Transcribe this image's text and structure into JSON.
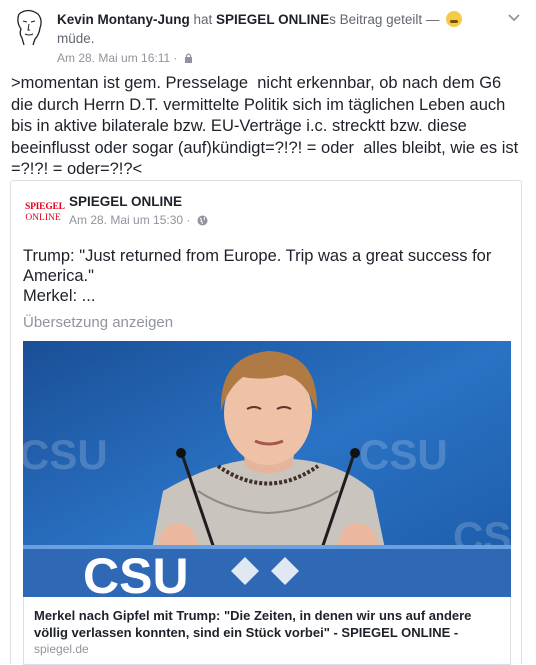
{
  "post": {
    "author": "Kevin Montany-Jung",
    "verb_before": " hat ",
    "shared_page": "SPIEGEL ONLINE",
    "verb_after": "s Beitrag geteilt — ",
    "feeling": "müde.",
    "timestamp": "Am 28. Mai um 16:11",
    "separator": "·",
    "status_text": ">momentan ist gem. Presselage  nicht erkennbar, ob nach dem G6  die durch Herrn D.T. vermittelte Politik sich im täglichen Leben auch bis in aktive bilaterale bzw. EU-Verträge i.c. strecktt bzw. diese  beeinflusst oder sogar (auf)kündigt=?!?! = oder  alles bleibt, wie es ist =?!?! = oder=?!?<"
  },
  "shared": {
    "logo_line1": "SPIEGEL",
    "logo_line2": "ONLINE",
    "page_name": "SPIEGEL ONLINE",
    "timestamp": "Am 28. Mai um 15:30",
    "separator": "·",
    "text": "Trump: \"Just returned from Europe. Trip was a great success for America.\"\nMerkel: ...",
    "translate_label": "Übersetzung anzeigen",
    "photo_banner_text": "CSU",
    "link_title": "Merkel nach Gipfel mit Trump: \"Die Zeiten, in denen wir uns auf andere völlig verlassen konnten, sind ein Stück vorbei\" - SPIEGEL ONLINE -",
    "link_domain": "spiegel.de"
  },
  "icons": {
    "avatar": "sketch-face-avatar",
    "privacy": "lock-icon",
    "audience": "globe-icon",
    "options": "chevron-down-icon",
    "feeling": "sleepy-emoji-icon"
  },
  "colors": {
    "text": "#1d2129",
    "secondary": "#616770",
    "meta": "#90949c",
    "spiegel_red": "#e2001a",
    "csu_blue": "#1f5fa8"
  }
}
